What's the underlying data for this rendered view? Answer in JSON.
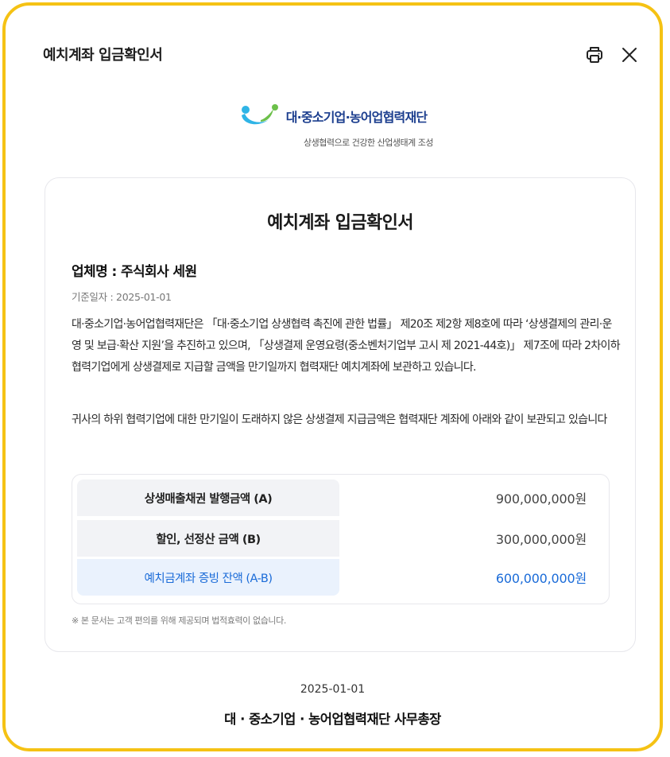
{
  "header": {
    "title": "예치계좌 입금확인서",
    "print_icon": "printer-icon",
    "close_icon": "close-icon"
  },
  "logo": {
    "name": "대·중소기업·농어업협력재단",
    "slogan": "상생협력으로 건강한 산업생태계 조성",
    "colors": {
      "blue": "#1d3f8f",
      "cyan": "#2fb4e6",
      "green": "#6cc04a"
    }
  },
  "document": {
    "title": "예치계좌 입금확인서",
    "company": "업체명 : 주식회사 세원",
    "base_date": "기준일자 : 2025-01-01",
    "paragraph1": "대·중소기업·농어업협력재단은 「대·중소기업 상생협력 촉진에 관한 법률」 제20조 제2항 제8호에 따라 ‘상생결제의 관리·운영 및 보급·확산 지원’을 추진하고 있으며, 「상생결제 운영요령(중소벤처기업부 고시 제 2021-44호)」 제7조에 따라 2차이하 협력기업에게 상생결제로 지급할 금액을 만기일까지 협력재단 예치계좌에 보관하고 있습니다.",
    "paragraph2": "귀사의 하위 협력기업에 대한 만기일이 도래하지 않은 상생결제 지급금액은 협력재단 계좌에 아래와 같이 보관되고 있습니다",
    "rows": [
      {
        "label": "상생매출채권 발행금액 (A)",
        "value": "900,000,000원"
      },
      {
        "label": "할인, 선정산 금액 (B)",
        "value": "300,000,000원"
      },
      {
        "label": "예치금계좌 증빙 잔액 (A-B)",
        "value": "600,000,000원"
      }
    ],
    "notice": "※ 본 문서는 고객 편의를 위해 제공되며 법적효력이 없습니다."
  },
  "footer": {
    "date": "2025-01-01",
    "signature": "대 · 중소기업 · 농어업협력재단 사무총장"
  },
  "colors": {
    "frame_border": "#f5c214",
    "highlight_text": "#1a6bd8",
    "highlight_bg": "#eaf2fd",
    "label_bg": "#f2f3f6"
  }
}
